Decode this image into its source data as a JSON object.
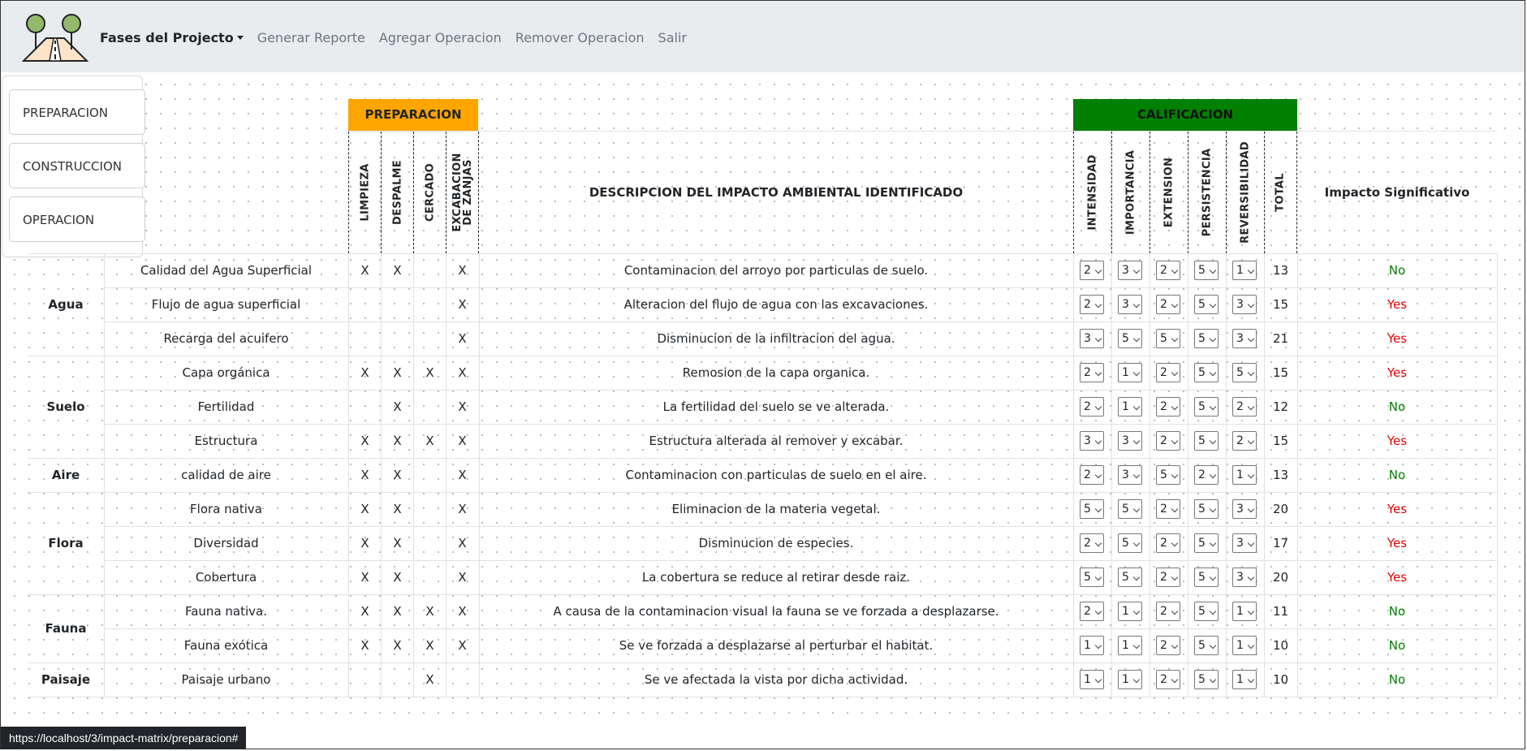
{
  "nav": {
    "brand": "Fases del Projecto",
    "links": [
      "Generar Reporte",
      "Agregar Operacion",
      "Remover Operacion",
      "Salir"
    ]
  },
  "phases": [
    "PREPARACION",
    "CONSTRUCCION",
    "OPERACION"
  ],
  "table": {
    "phase_header": "PREPARACION",
    "phase_header_color": "#ffa500",
    "calificacion_header": "CALIFICACION",
    "calificacion_color": "#008000",
    "activity_columns": [
      "LIMPIEZA",
      "DESPALME",
      "CERCADO",
      "EXCABACION DE ZANJAS"
    ],
    "description_header": "DESCRIPCION DEL IMPACTO AMBIENTAL IDENTIFICADO",
    "rating_columns": [
      "INTENSIDAD",
      "IMPORTANCIA",
      "EXTENSION",
      "PERSISTENCIA",
      "REVERSIBILIDAD"
    ],
    "total_header": "TOTAL",
    "impact_header": "Impacto Significativo",
    "categories": [
      "Agua",
      "Suelo",
      "Aire",
      "Flora",
      "Fauna",
      "Paisaje"
    ],
    "rows": [
      {
        "factor": "Calidad del Agua Superficial",
        "marks": [
          "X",
          "X",
          "",
          "X"
        ],
        "description": "Contaminacion del arroyo por particulas de suelo.",
        "ratings": [
          "2",
          "3",
          "2",
          "5",
          "1"
        ],
        "total": "13",
        "impact": "No"
      },
      {
        "factor": "Flujo de agua superficial",
        "marks": [
          "",
          "",
          "",
          "X"
        ],
        "description": "Alteracion del flujo de agua con las excavaciones.",
        "ratings": [
          "2",
          "3",
          "2",
          "5",
          "3"
        ],
        "total": "15",
        "impact": "Yes"
      },
      {
        "factor": "Recarga del acuifero",
        "marks": [
          "",
          "",
          "",
          "X"
        ],
        "description": "Disminucion de la infiltracion del agua.",
        "ratings": [
          "3",
          "5",
          "5",
          "5",
          "3"
        ],
        "total": "21",
        "impact": "Yes"
      },
      {
        "factor": "Capa orgánica",
        "marks": [
          "X",
          "X",
          "X",
          "X"
        ],
        "description": "Remosion de la capa organica.",
        "ratings": [
          "2",
          "1",
          "2",
          "5",
          "5"
        ],
        "total": "15",
        "impact": "Yes"
      },
      {
        "factor": "Fertilidad",
        "marks": [
          "",
          "X",
          "",
          "X"
        ],
        "description": "La fertilidad del suelo se ve alterada.",
        "ratings": [
          "2",
          "1",
          "2",
          "5",
          "2"
        ],
        "total": "12",
        "impact": "No"
      },
      {
        "factor": "Estructura",
        "marks": [
          "X",
          "X",
          "X",
          "X"
        ],
        "description": "Estructura alterada al remover y excabar.",
        "ratings": [
          "3",
          "3",
          "2",
          "5",
          "2"
        ],
        "total": "15",
        "impact": "Yes"
      },
      {
        "factor": "calidad de aire",
        "marks": [
          "X",
          "X",
          "",
          "X"
        ],
        "description": "Contaminacion con particulas de suelo en el aire.",
        "ratings": [
          "2",
          "3",
          "5",
          "2",
          "1"
        ],
        "total": "13",
        "impact": "No"
      },
      {
        "factor": "Flora nativa",
        "marks": [
          "X",
          "X",
          "",
          "X"
        ],
        "description": "Eliminacion de la materia vegetal.",
        "ratings": [
          "5",
          "5",
          "2",
          "5",
          "3"
        ],
        "total": "20",
        "impact": "Yes"
      },
      {
        "factor": "Diversidad",
        "marks": [
          "X",
          "X",
          "",
          "X"
        ],
        "description": "Disminucion de especies.",
        "ratings": [
          "2",
          "5",
          "2",
          "5",
          "3"
        ],
        "total": "17",
        "impact": "Yes"
      },
      {
        "factor": "Cobertura",
        "marks": [
          "X",
          "X",
          "",
          "X"
        ],
        "description": "La cobertura se reduce al retirar desde raiz.",
        "ratings": [
          "5",
          "5",
          "2",
          "5",
          "3"
        ],
        "total": "20",
        "impact": "Yes"
      },
      {
        "factor": "Fauna nativa.",
        "marks": [
          "X",
          "X",
          "X",
          "X"
        ],
        "description": "A causa de la contaminacion visual la fauna se ve forzada a desplazarse.",
        "ratings": [
          "2",
          "1",
          "2",
          "5",
          "1"
        ],
        "total": "11",
        "impact": "No"
      },
      {
        "factor": "Fauna exótica",
        "marks": [
          "X",
          "X",
          "X",
          "X"
        ],
        "description": "Se ve forzada a desplazarse al perturbar el habitat.",
        "ratings": [
          "1",
          "1",
          "2",
          "5",
          "1"
        ],
        "total": "10",
        "impact": "No"
      },
      {
        "factor": "Paisaje urbano",
        "marks": [
          "",
          "",
          "X",
          ""
        ],
        "description": "Se ve afectada la vista por dicha actividad.",
        "ratings": [
          "1",
          "1",
          "2",
          "5",
          "1"
        ],
        "total": "10",
        "impact": "No"
      }
    ],
    "impact_colors": {
      "Yes": "#e60000",
      "No": "#008000"
    }
  },
  "status_url": "https://localhost/3/impact-matrix/preparacion#"
}
